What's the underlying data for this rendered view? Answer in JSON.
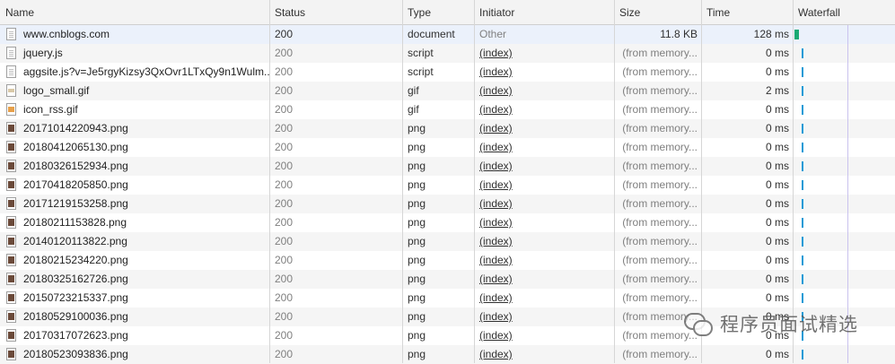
{
  "columns": [
    "Name",
    "Status",
    "Type",
    "Initiator",
    "Size",
    "Time",
    "Waterfall"
  ],
  "rows": [
    {
      "name": "www.cnblogs.com",
      "status": "200",
      "type": "document",
      "initiator": "Other",
      "size": "11.8 KB",
      "time": "128 ms",
      "icon": "document-icon"
    },
    {
      "name": "jquery.js",
      "status": "200",
      "type": "script",
      "initiator": "(index)",
      "size": "(from memory...",
      "time": "0 ms",
      "icon": "script-file-icon"
    },
    {
      "name": "aggsite.js?v=Je5rgyKizsy3QxOvr1LTxQy9n1Wulm...",
      "status": "200",
      "type": "script",
      "initiator": "(index)",
      "size": "(from memory...",
      "time": "0 ms",
      "icon": "script-file-icon"
    },
    {
      "name": "logo_small.gif",
      "status": "200",
      "type": "gif",
      "initiator": "(index)",
      "size": "(from memory...",
      "time": "2 ms",
      "icon": "gif-image-icon"
    },
    {
      "name": "icon_rss.gif",
      "status": "200",
      "type": "gif",
      "initiator": "(index)",
      "size": "(from memory...",
      "time": "0 ms",
      "icon": "gif-image-icon"
    },
    {
      "name": "20171014220943.png",
      "status": "200",
      "type": "png",
      "initiator": "(index)",
      "size": "(from memory...",
      "time": "0 ms",
      "icon": "png-image-icon"
    },
    {
      "name": "20180412065130.png",
      "status": "200",
      "type": "png",
      "initiator": "(index)",
      "size": "(from memory...",
      "time": "0 ms",
      "icon": "png-image-icon"
    },
    {
      "name": "20180326152934.png",
      "status": "200",
      "type": "png",
      "initiator": "(index)",
      "size": "(from memory...",
      "time": "0 ms",
      "icon": "png-image-icon"
    },
    {
      "name": "20170418205850.png",
      "status": "200",
      "type": "png",
      "initiator": "(index)",
      "size": "(from memory...",
      "time": "0 ms",
      "icon": "png-image-icon"
    },
    {
      "name": "20171219153258.png",
      "status": "200",
      "type": "png",
      "initiator": "(index)",
      "size": "(from memory...",
      "time": "0 ms",
      "icon": "png-image-icon"
    },
    {
      "name": "20180211153828.png",
      "status": "200",
      "type": "png",
      "initiator": "(index)",
      "size": "(from memory...",
      "time": "0 ms",
      "icon": "png-image-icon"
    },
    {
      "name": "20140120113822.png",
      "status": "200",
      "type": "png",
      "initiator": "(index)",
      "size": "(from memory...",
      "time": "0 ms",
      "icon": "png-image-icon"
    },
    {
      "name": "20180215234220.png",
      "status": "200",
      "type": "png",
      "initiator": "(index)",
      "size": "(from memory...",
      "time": "0 ms",
      "icon": "png-image-icon"
    },
    {
      "name": "20180325162726.png",
      "status": "200",
      "type": "png",
      "initiator": "(index)",
      "size": "(from memory...",
      "time": "0 ms",
      "icon": "png-image-icon"
    },
    {
      "name": "20150723215337.png",
      "status": "200",
      "type": "png",
      "initiator": "(index)",
      "size": "(from memory...",
      "time": "0 ms",
      "icon": "png-image-icon"
    },
    {
      "name": "20180529100036.png",
      "status": "200",
      "type": "png",
      "initiator": "(index)",
      "size": "(from memory...",
      "time": "0 ms",
      "icon": "png-image-icon"
    },
    {
      "name": "20170317072623.png",
      "status": "200",
      "type": "png",
      "initiator": "(index)",
      "size": "(from memory...",
      "time": "0 ms",
      "icon": "png-image-icon"
    },
    {
      "name": "20180523093836.png",
      "status": "200",
      "type": "png",
      "initiator": "(index)",
      "size": "(from memory...",
      "time": "0 ms",
      "icon": "png-image-icon"
    }
  ],
  "watermark": {
    "text": "程序员面试精选",
    "icon": "wechat-icon"
  },
  "colors": {
    "waterfall_document": "#19a974",
    "waterfall_cached": "#1a9ad6",
    "selected_row": "#ebf1fb"
  }
}
